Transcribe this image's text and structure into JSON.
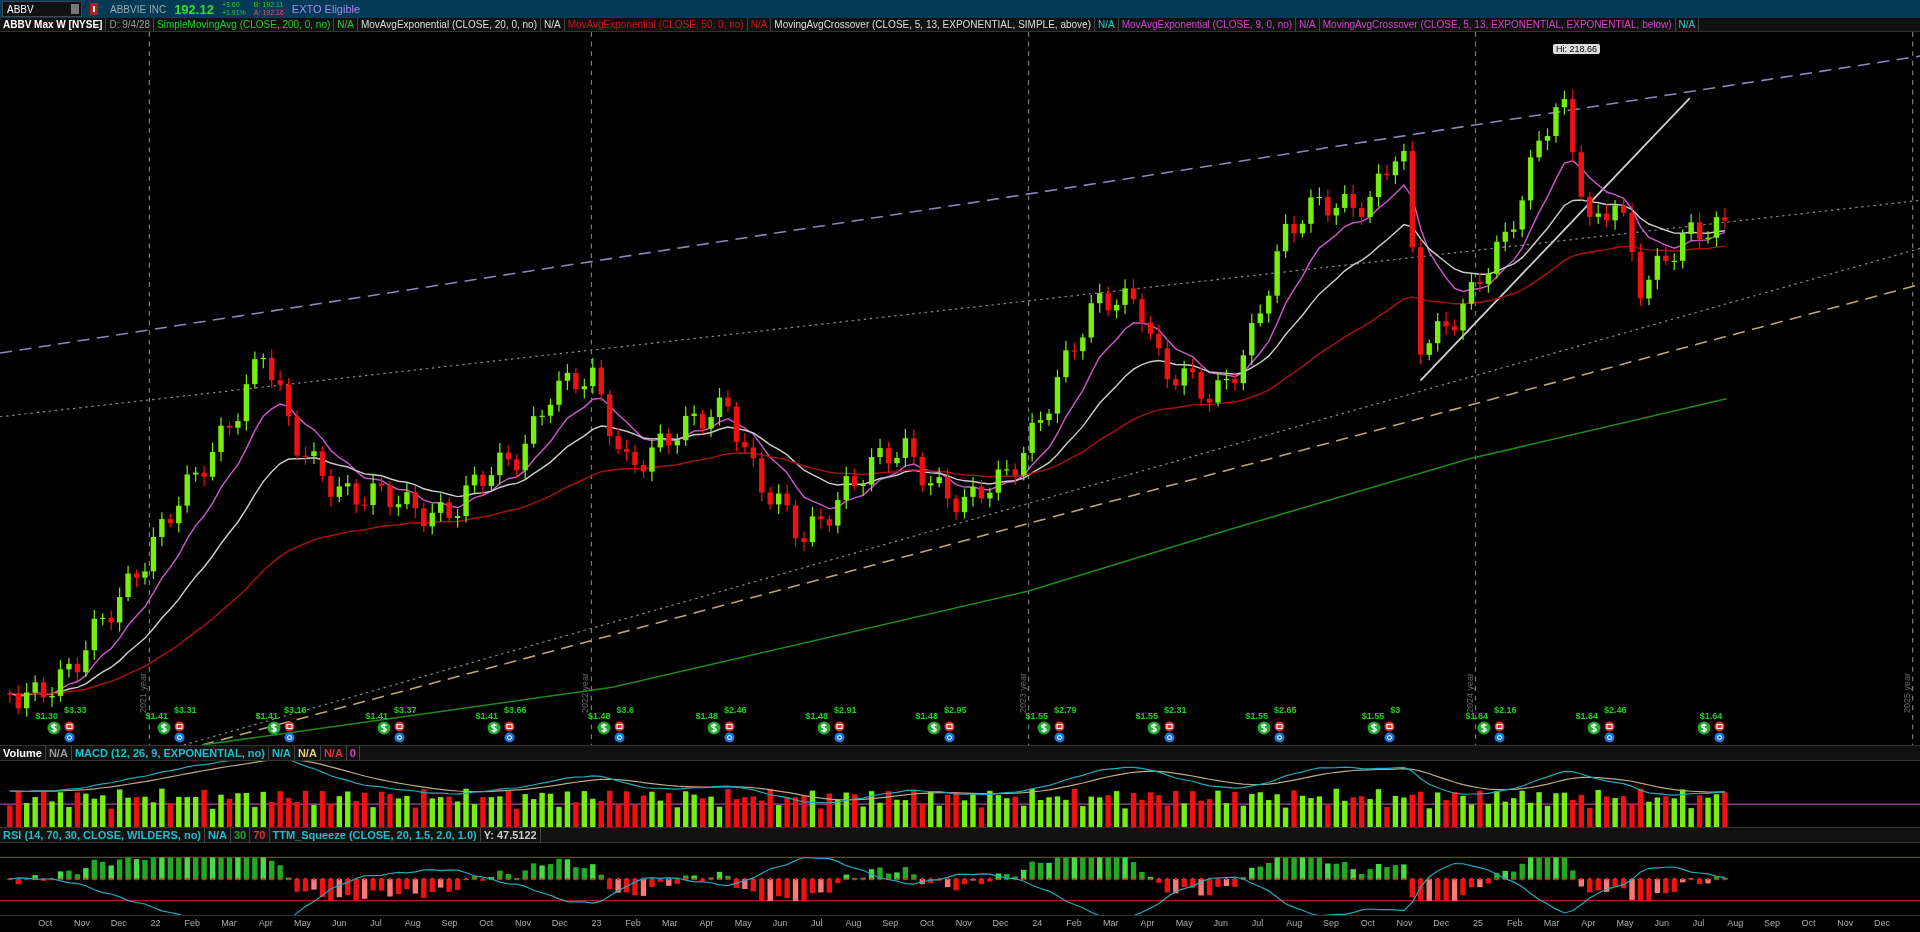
{
  "toolbar": {
    "symbol": "ABBV",
    "company": "ABBVIE INC",
    "last": "192.12",
    "change": "+3.60",
    "change_pct": "+1.91%",
    "bid": "B: 192.11",
    "ask": "A: 192.16",
    "badge": "EXTO Eligible"
  },
  "chart": {
    "title": "ABBV Max W [NYSE]",
    "date": "D: 9/4/28",
    "studies": [
      {
        "text": "SimpleMovingAvg (CLOSE, 200, 0, no)",
        "color": "#22cc22"
      },
      {
        "text": "N/A",
        "color": "#22cc22"
      },
      {
        "text": "MovAvgExponential (CLOSE, 20, 0, no)",
        "color": "#dddddd"
      },
      {
        "text": "N/A",
        "color": "#dddddd"
      },
      {
        "text": "MovAvgExponential (CLOSE, 50, 0, no)",
        "color": "#cc1111"
      },
      {
        "text": "N/A",
        "color": "#cc1111"
      },
      {
        "text": "MovingAvgCrossover (CLOSE, 5, 13, EXPONENTIAL, SIMPLE, above)",
        "color": "#dddddd"
      },
      {
        "text": "N/A",
        "color": "#22cccc"
      },
      {
        "text": "MovAvgExponential (CLOSE, 9, 0, no)",
        "color": "#cc44cc"
      },
      {
        "text": "N/A",
        "color": "#cc44cc"
      },
      {
        "text": "MovingAvgCrossover (CLOSE, 5, 13, EXPONENTIAL, EXPONENTIAL, below)",
        "color": "#cc44cc"
      },
      {
        "text": "N/A",
        "color": "#22cccc"
      }
    ],
    "high_label": "Hi: 218.66",
    "year_markers": [
      "2021 year",
      "2022 year",
      "2023 year",
      "2024 year",
      "2025 year"
    ],
    "events": [
      {
        "dividend": "$1.30",
        "earnings": "$3.33"
      },
      {
        "dividend": "$1.41",
        "earnings": "$3.31"
      },
      {
        "dividend": "$1.41",
        "earnings": "$3.16"
      },
      {
        "dividend": "$1.41",
        "earnings": "$3.37"
      },
      {
        "dividend": "$1.41",
        "earnings": "$3.66"
      },
      {
        "dividend": "$1.48",
        "earnings": "$3.6"
      },
      {
        "dividend": "$1.48",
        "earnings": "$2.46"
      },
      {
        "dividend": "$1.48",
        "earnings": "$2.91"
      },
      {
        "dividend": "$1.48",
        "earnings": "$2.95"
      },
      {
        "dividend": "$1.55",
        "earnings": "$2.79"
      },
      {
        "dividend": "$1.55",
        "earnings": "$2.31"
      },
      {
        "dividend": "$1.55",
        "earnings": "$2.65"
      },
      {
        "dividend": "$1.55",
        "earnings": "$3"
      },
      {
        "dividend": "$1.64",
        "earnings": "$2.16"
      },
      {
        "dividend": "$1.64",
        "earnings": "$2.46"
      },
      {
        "dividend": "$1.64"
      }
    ]
  },
  "lower_panels": [
    {
      "studies": [
        {
          "text": "Volume",
          "color": "#ffffff"
        },
        {
          "text": "N/A",
          "color": "#999999"
        },
        {
          "text": "MACD (12, 26, 9, EXPONENTIAL, no)",
          "color": "#22bbcc"
        },
        {
          "text": "N/A",
          "color": "#22bbcc"
        },
        {
          "text": "N/A",
          "color": "#ddcc88"
        },
        {
          "text": "N/A",
          "color": "#dd3333"
        },
        {
          "text": "0",
          "color": "#cc44cc"
        }
      ]
    },
    {
      "studies": [
        {
          "text": "RSI (14, 70, 30, CLOSE, WILDERS, no)",
          "color": "#22bbcc"
        },
        {
          "text": "N/A",
          "color": "#22bbcc"
        },
        {
          "text": "30",
          "color": "#22aa22"
        },
        {
          "text": "70",
          "color": "#dd3333"
        },
        {
          "text": "TTM_Squeeze (CLOSE, 20, 1.5, 2.0, 1.0)",
          "color": "#22bbcc"
        },
        {
          "text": "Y: 47.5122",
          "color": "#cccccc"
        }
      ]
    }
  ],
  "x_axis": [
    "Oct",
    "Nov",
    "Dec",
    "22",
    "Feb",
    "Mar",
    "Apr",
    "May",
    "Jun",
    "Jul",
    "Aug",
    "Sep",
    "Oct",
    "Nov",
    "Dec",
    "23",
    "Feb",
    "Mar",
    "Apr",
    "May",
    "Jun",
    "Jul",
    "Aug",
    "Sep",
    "Oct",
    "Nov",
    "Dec",
    "24",
    "Feb",
    "Mar",
    "Apr",
    "May",
    "Jun",
    "Jul",
    "Aug",
    "Sep",
    "Oct",
    "Nov",
    "Dec",
    "25",
    "Feb",
    "Mar",
    "Apr",
    "May",
    "Jun",
    "Jul",
    "Aug",
    "Sep",
    "Oct",
    "Nov",
    "Dec"
  ]
}
